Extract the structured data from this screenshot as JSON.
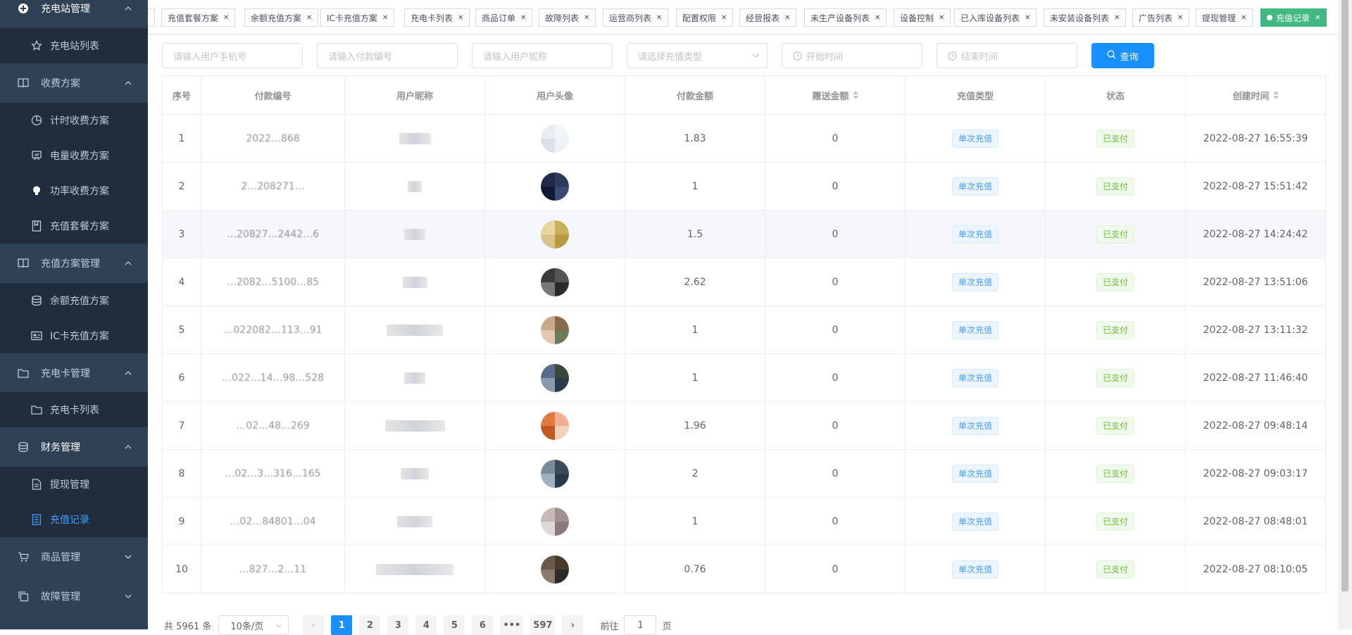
{
  "sidebar": {
    "items": [
      {
        "label": "充电站管理",
        "icon": "plus-circle-icon"
      },
      {
        "label": "充电站列表",
        "icon": "star-icon"
      },
      {
        "label": "收费方案",
        "icon": "book-icon"
      },
      {
        "label": "计时收费方案",
        "icon": "clock-icon"
      },
      {
        "label": "电量收费方案",
        "icon": "easel-icon"
      },
      {
        "label": "功率收费方案",
        "icon": "bulb-icon"
      },
      {
        "label": "充值套餐方案",
        "icon": "bookmark-icon"
      },
      {
        "label": "充值方案管理",
        "icon": "book-icon"
      },
      {
        "label": "余额充值方案",
        "icon": "coins-icon"
      },
      {
        "label": "IC卡充值方案",
        "icon": "card-icon"
      },
      {
        "label": "充电卡管理",
        "icon": "folder-icon"
      },
      {
        "label": "充电卡列表",
        "icon": "folder-icon"
      },
      {
        "label": "财务管理",
        "icon": "coins-icon"
      },
      {
        "label": "提现管理",
        "icon": "document-icon"
      },
      {
        "label": "充值记录",
        "icon": "list-icon"
      },
      {
        "label": "商品管理",
        "icon": "cart-icon"
      },
      {
        "label": "故障管理",
        "icon": "copy-icon"
      }
    ]
  },
  "tags": [
    "充值套餐方案",
    "余额充值方案",
    "IC卡充值方案",
    "充电卡列表",
    "商品订单",
    "故障列表",
    "运营商列表",
    "配置权限",
    "经营报表",
    "未生产设备列表",
    "设备控制",
    "已入库设备列表",
    "未安装设备列表",
    "广告列表",
    "提现管理",
    "充值记录"
  ],
  "filters": {
    "phone_placeholder": "请输入用户手机号",
    "payment_no_placeholder": "请输入付款编号",
    "nickname_placeholder": "请输入用户昵称",
    "type_placeholder": "请选择充值类型",
    "start_placeholder": "开始时间",
    "end_placeholder": "结束时间",
    "query_label": "查询"
  },
  "table": {
    "headers": [
      "序号",
      "付款编号",
      "用户昵称",
      "用户头像",
      "付款金额",
      "赠送金额",
      "充值类型",
      "状态",
      "创建时间"
    ],
    "rows": [
      {
        "index": "1",
        "payment_no": "2022…868",
        "amount": "1.83",
        "bonus": "0",
        "type": "单次充值",
        "status": "已支付",
        "created": "2022-08-27 16:55:39"
      },
      {
        "index": "2",
        "payment_no": "2…208271…",
        "amount": "1",
        "bonus": "0",
        "type": "单次充值",
        "status": "已支付",
        "created": "2022-08-27 15:51:42"
      },
      {
        "index": "3",
        "payment_no": "…20827…2442…6",
        "amount": "1.5",
        "bonus": "0",
        "type": "单次充值",
        "status": "已支付",
        "created": "2022-08-27 14:24:42"
      },
      {
        "index": "4",
        "payment_no": "…2082…5100…85",
        "amount": "2.62",
        "bonus": "0",
        "type": "单次充值",
        "status": "已支付",
        "created": "2022-08-27 13:51:06"
      },
      {
        "index": "5",
        "payment_no": "…022082…113…91",
        "amount": "1",
        "bonus": "0",
        "type": "单次充值",
        "status": "已支付",
        "created": "2022-08-27 13:11:32"
      },
      {
        "index": "6",
        "payment_no": "…022…14…98…528",
        "amount": "1",
        "bonus": "0",
        "type": "单次充值",
        "status": "已支付",
        "created": "2022-08-27 11:46:40"
      },
      {
        "index": "7",
        "payment_no": "…02…48…269",
        "amount": "1.96",
        "bonus": "0",
        "type": "单次充值",
        "status": "已支付",
        "created": "2022-08-27 09:48:14"
      },
      {
        "index": "8",
        "payment_no": "…02…3…316…165",
        "amount": "2",
        "bonus": "0",
        "type": "单次充值",
        "status": "已支付",
        "created": "2022-08-27 09:03:17"
      },
      {
        "index": "9",
        "payment_no": "…02…84801…04",
        "amount": "1",
        "bonus": "0",
        "type": "单次充值",
        "status": "已支付",
        "created": "2022-08-27 08:48:01"
      },
      {
        "index": "10",
        "payment_no": "…827…2…11",
        "amount": "0.76",
        "bonus": "0",
        "type": "单次充值",
        "status": "已支付",
        "created": "2022-08-27 08:10:05"
      }
    ]
  },
  "pagination": {
    "total": "共 5961 条",
    "page_size": "10条/页",
    "pages": [
      "1",
      "2",
      "3",
      "4",
      "5",
      "6",
      "•••",
      "597"
    ],
    "prev": "‹",
    "next": "›",
    "goto_label": "前往",
    "goto_value": "1",
    "page_suffix": "页"
  },
  "colors": {
    "sidebar_bg": "#304156",
    "submenu_bg": "#1f2d3d",
    "active_text": "#409eff",
    "active_tag": "#42b983",
    "primary_button": "#1890ff"
  }
}
